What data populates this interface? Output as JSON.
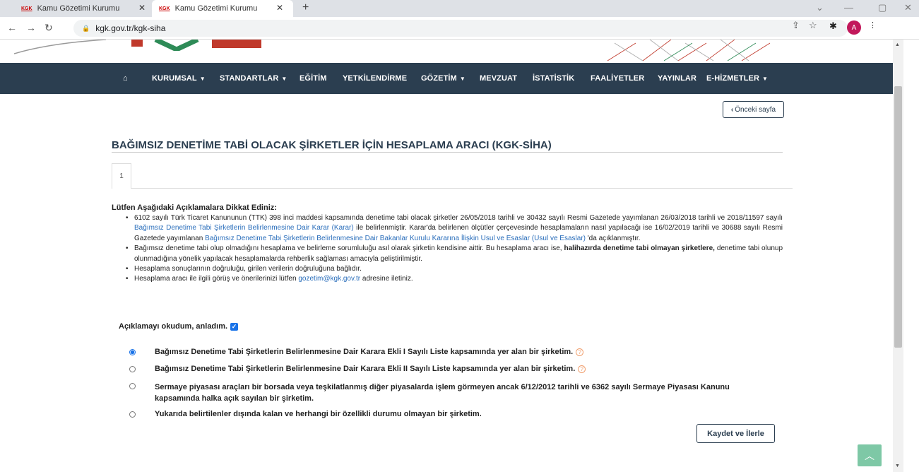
{
  "browser": {
    "tabs": [
      {
        "favicon": "KGK",
        "title": "Kamu Gözetimi Kurumu"
      },
      {
        "favicon": "KGK",
        "title": "Kamu Gözetimi Kurumu"
      }
    ],
    "url": "kgk.gov.tr/kgk-siha",
    "avatar_letter": "A"
  },
  "nav": {
    "home_icon": "home-icon",
    "items": [
      {
        "label": "KURUMSAL",
        "dropdown": true
      },
      {
        "label": "STANDARTLAR",
        "dropdown": true
      },
      {
        "label": "EĞİTİM",
        "dropdown": false
      },
      {
        "label": "YETKİLENDİRME",
        "dropdown": false
      },
      {
        "label": "GÖZETİM",
        "dropdown": true
      },
      {
        "label": "MEVZUAT",
        "dropdown": false
      },
      {
        "label": "İSTATİSTİK",
        "dropdown": false
      },
      {
        "label": "FAALİYETLER",
        "dropdown": false
      },
      {
        "label": "YAYINLAR",
        "dropdown": false
      },
      {
        "label": "E-HİZMETLER",
        "dropdown": true
      }
    ]
  },
  "back_button": "Önceki sayfa",
  "page_title": "BAĞIMSIZ DENETİME TABİ OLACAK ŞİRKETLER İÇİN HESAPLAMA ARACI (KGK-SİHA)",
  "step_tab": "1",
  "notice": {
    "heading": "Lütfen Aşağıdaki Açıklamalara Dikkat Ediniz:",
    "b1_p1": "6102 sayılı Türk Ticaret Kanununun (TTK) 398 inci maddesi kapsamında denetime tabi olacak şirketler 26/05/2018 tarihli ve 30432 sayılı Resmi Gazetede yayımlanan 26/03/2018 tarihli ve 2018/11597 sayılı ",
    "b1_link1": "Bağımsız Denetime Tabi Şirketlerin Belirlenmesine Dair Karar (Karar)",
    "b1_p2": " ile belirlenmiştir. Karar'da belirlenen ölçütler çerçevesinde hesaplamaların nasıl yapılacağı ise 16/02/2019 tarihli ve 30688 sayılı Resmi Gazetede yayımlanan ",
    "b1_link2": "Bağımsız Denetime Tabi Şirketlerin Belirlenmesine Dair Bakanlar Kurulu Kararına İlişkin Usul ve Esaslar (Usul ve Esaslar)",
    "b1_p3": " 'da açıklanmıştır.",
    "b2_p1": "Bağımsız denetime tabi olup olmadığını hesaplama ve belirleme sorumluluğu asıl olarak şirketin kendisine aittir. Bu hesaplama aracı ise, ",
    "b2_bold": "halihazırda denetime tabi olmayan şirketlere,",
    "b2_p2": " denetime tabi olunup olunmadığına yönelik yapılacak hesaplamalarda rehberlik sağlaması amacıyla geliştirilmiştir.",
    "b3": "Hesaplama sonuçlarının doğruluğu, girilen verilerin doğruluğuna bağlıdır.",
    "b4_p1": "Hesaplama aracı ile ilgili görüş ve önerilerinizi lütfen ",
    "b4_link": "gozetim@kgk.gov.tr",
    "b4_p2": " adresine iletiniz."
  },
  "acknowledge": {
    "label": "Açıklamayı okudum, anladım.",
    "checked": true
  },
  "options": [
    {
      "label": "Bağımsız Denetime Tabi Şirketlerin Belirlenmesine Dair Karara Ekli I Sayılı Liste kapsamında yer alan bir şirketim.",
      "selected": true,
      "help": "?"
    },
    {
      "label": "Bağımsız Denetime Tabi Şirketlerin Belirlenmesine Dair Karara Ekli II Sayılı Liste kapsamında yer alan bir şirketim.",
      "selected": false,
      "help": "?"
    },
    {
      "label": "Sermaye piyasası araçları bir borsada veya teşkilatlanmış diğer piyasalarda işlem görmeyen ancak 6/12/2012 tarihli ve 6362 sayılı Sermaye Piyasası Kanunu kapsamında halka açık sayılan bir şirketim.",
      "selected": false
    },
    {
      "label": "Yukarıda belirtilenler dışında kalan ve herhangi bir özellikli durumu olmayan bir şirketim.",
      "selected": false
    }
  ],
  "save_button": "Kaydet ve İlerle",
  "colors": {
    "navbar": "#2b3e50",
    "link": "#2a6ebb",
    "accent": "#1a73e8",
    "to_top": "#7ec8a6"
  }
}
